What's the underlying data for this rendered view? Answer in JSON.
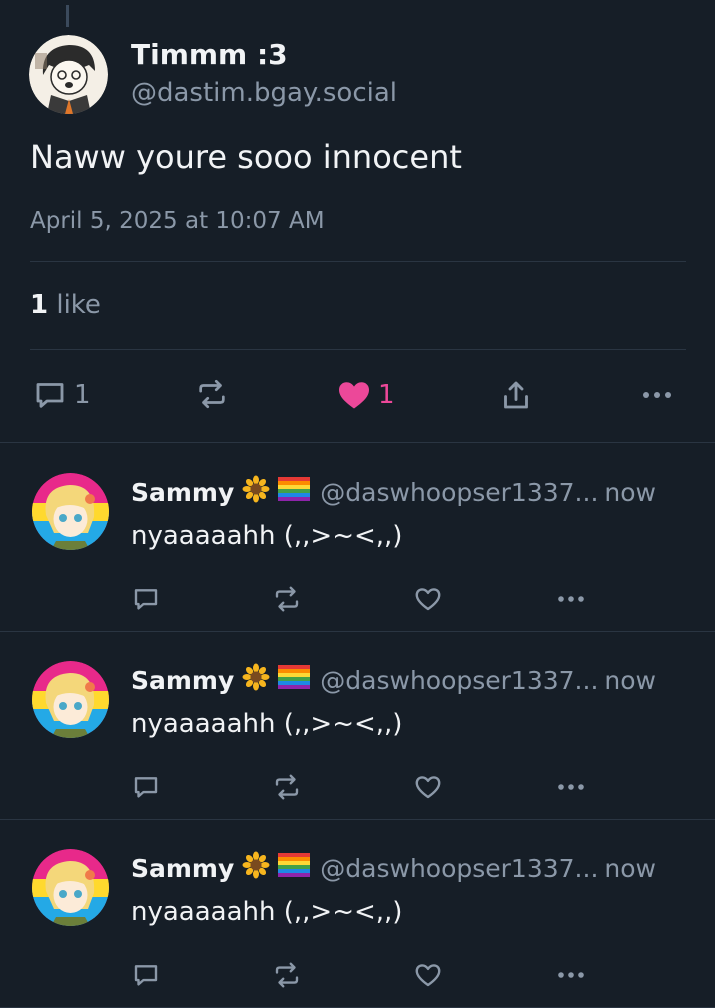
{
  "post": {
    "author_name": "Timmm :3",
    "author_handle": "@dastim.bgay.social",
    "text": "Naww youre sooo innocent",
    "timestamp": "April 5, 2025 at 10:07 AM",
    "likes_count": "1",
    "likes_label": " like",
    "actions": {
      "reply_count": "1",
      "like_count": "1",
      "liked": true
    }
  },
  "replies": [
    {
      "author_name": "Sammy",
      "emojis": [
        "sunflower",
        "rainbow-flag"
      ],
      "author_handle": "@daswhoopser1337...",
      "time": "now",
      "text": "nyaaaaahh (,,>~<,,)"
    },
    {
      "author_name": "Sammy",
      "emojis": [
        "sunflower",
        "rainbow-flag"
      ],
      "author_handle": "@daswhoopser1337...",
      "time": "now",
      "text": "nyaaaaahh (,,>~<,,)"
    },
    {
      "author_name": "Sammy",
      "emojis": [
        "sunflower",
        "rainbow-flag"
      ],
      "author_handle": "@daswhoopser1337...",
      "time": "now",
      "text": "nyaaaaahh (,,>~<,,)"
    }
  ],
  "colors": {
    "background": "#161e27",
    "text_primary": "#f1f3f5",
    "text_secondary": "#8b98a8",
    "divider": "#2a3542",
    "like_accent": "#ec4899"
  }
}
